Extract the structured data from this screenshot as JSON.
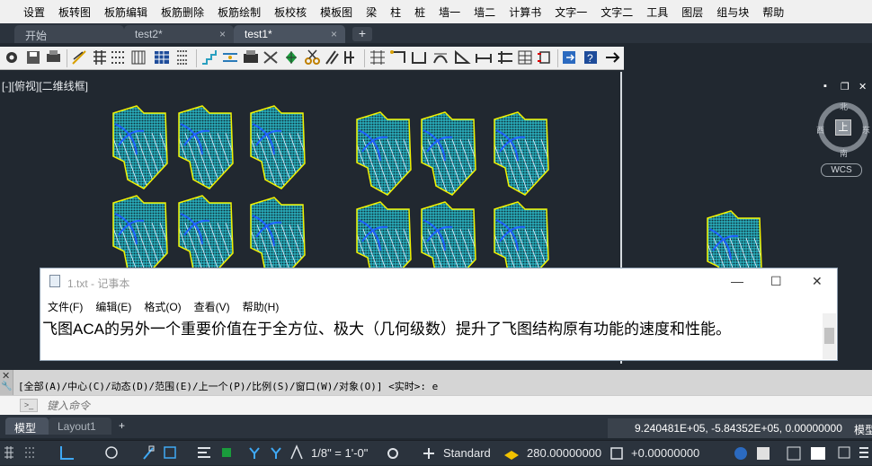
{
  "menu": [
    "设置",
    "板转图",
    "板筋编辑",
    "板筋删除",
    "板筋绘制",
    "板校核",
    "模板图",
    "梁",
    "柱",
    "桩",
    "墙一",
    "墙二",
    "计算书",
    "文字一",
    "文字二",
    "工具",
    "图层",
    "组与块",
    "帮助"
  ],
  "tabs": [
    {
      "label": "开始",
      "close": ""
    },
    {
      "label": "test2*",
      "close": "×"
    },
    {
      "label": "test1*",
      "close": "×"
    }
  ],
  "tab_add": "+",
  "viewport": {
    "label": "[-][俯视][二维线框]",
    "window_controls": [
      "▪",
      "❐",
      "✕"
    ],
    "viewcube": {
      "north": "北",
      "south": "南",
      "east": "东",
      "west": "西",
      "face": "上"
    },
    "wcs_label": "WCS"
  },
  "notepad": {
    "title": "1.txt - 记事本",
    "controls": [
      "—",
      "☐",
      "✕"
    ],
    "menu": [
      "文件(F)",
      "编辑(E)",
      "格式(O)",
      "查看(V)",
      "帮助(H)"
    ],
    "content": "飞图ACA的另外一个重要价值在于全方位、极大（几何级数）提升了飞图结构原有功能的速度和性能。"
  },
  "command": {
    "history": "[全部(A)/中心(C)/动态(D)/范围(E)/上一个(P)/比例(S)/窗口(W)/对象(O)] <实时>: e",
    "close": "✕",
    "tool": "🔧",
    "prompt_icon": ">_",
    "placeholder": "键入命令"
  },
  "layout_tabs": [
    "模型",
    "Layout1",
    "+"
  ],
  "coordinates": "9.240481E+05, -5.84352E+05, 0.00000000",
  "coord_suffix": "模型",
  "status": {
    "scale": "1/8\" = 1'-0\"",
    "style": "Standard",
    "lineweight": "280.00000000",
    "elevation": "+0.00000000"
  },
  "colors": {
    "rebar_main": "#30d0e0",
    "rebar_yellow": "#f2f200",
    "rebar_blue": "#2060ff",
    "rebar_white": "#e8f0ff"
  }
}
